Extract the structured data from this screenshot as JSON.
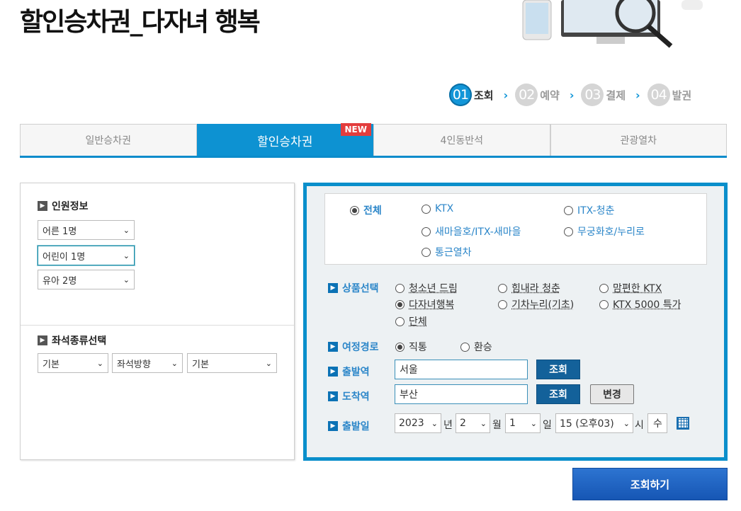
{
  "page": {
    "title": "할인승차권_다자녀 행복"
  },
  "steps": [
    {
      "num": "01",
      "label": "조회"
    },
    {
      "num": "02",
      "label": "예약"
    },
    {
      "num": "03",
      "label": "결제"
    },
    {
      "num": "04",
      "label": "발권"
    }
  ],
  "tabs": [
    {
      "label": "일반승차권"
    },
    {
      "label": "할인승차권",
      "badge": "NEW"
    },
    {
      "label": "4인동반석"
    },
    {
      "label": "관광열차"
    }
  ],
  "passenger": {
    "heading": "인원정보",
    "adult": "어른 1명",
    "child": "어린이 1명",
    "infant": "유아 2명"
  },
  "seat": {
    "heading": "좌석종류선택",
    "type": "기본",
    "direction": "좌석방향",
    "option": "기본"
  },
  "train_types": {
    "all": "전체",
    "ktx": "KTX",
    "itx": "ITX-청춘",
    "saemaeul": "새마을호/ITX-새마을",
    "mugunghwa": "무궁화호/누리로",
    "commuter": "통근열차"
  },
  "product": {
    "label": "상품선택",
    "options": [
      "청소년 드림",
      "힘내라 청춘",
      "맘편한 KTX",
      "다자녀행복",
      "기차누리(기초)",
      "KTX 5000 특가",
      "단체"
    ]
  },
  "route": {
    "label": "여정경로",
    "direct": "직통",
    "transfer": "환승"
  },
  "departure": {
    "label": "출발역",
    "value": "서울",
    "button": "조회"
  },
  "arrival": {
    "label": "도착역",
    "value": "부산",
    "button": "조회",
    "swap": "변경"
  },
  "date": {
    "label": "출발일",
    "year": "2023",
    "year_unit": "년",
    "month": "2",
    "month_unit": "월",
    "day": "1",
    "day_unit": "일",
    "hour": "15 (오후03)",
    "hour_unit": "시",
    "weekday": "수"
  },
  "submit": "조회하기"
}
